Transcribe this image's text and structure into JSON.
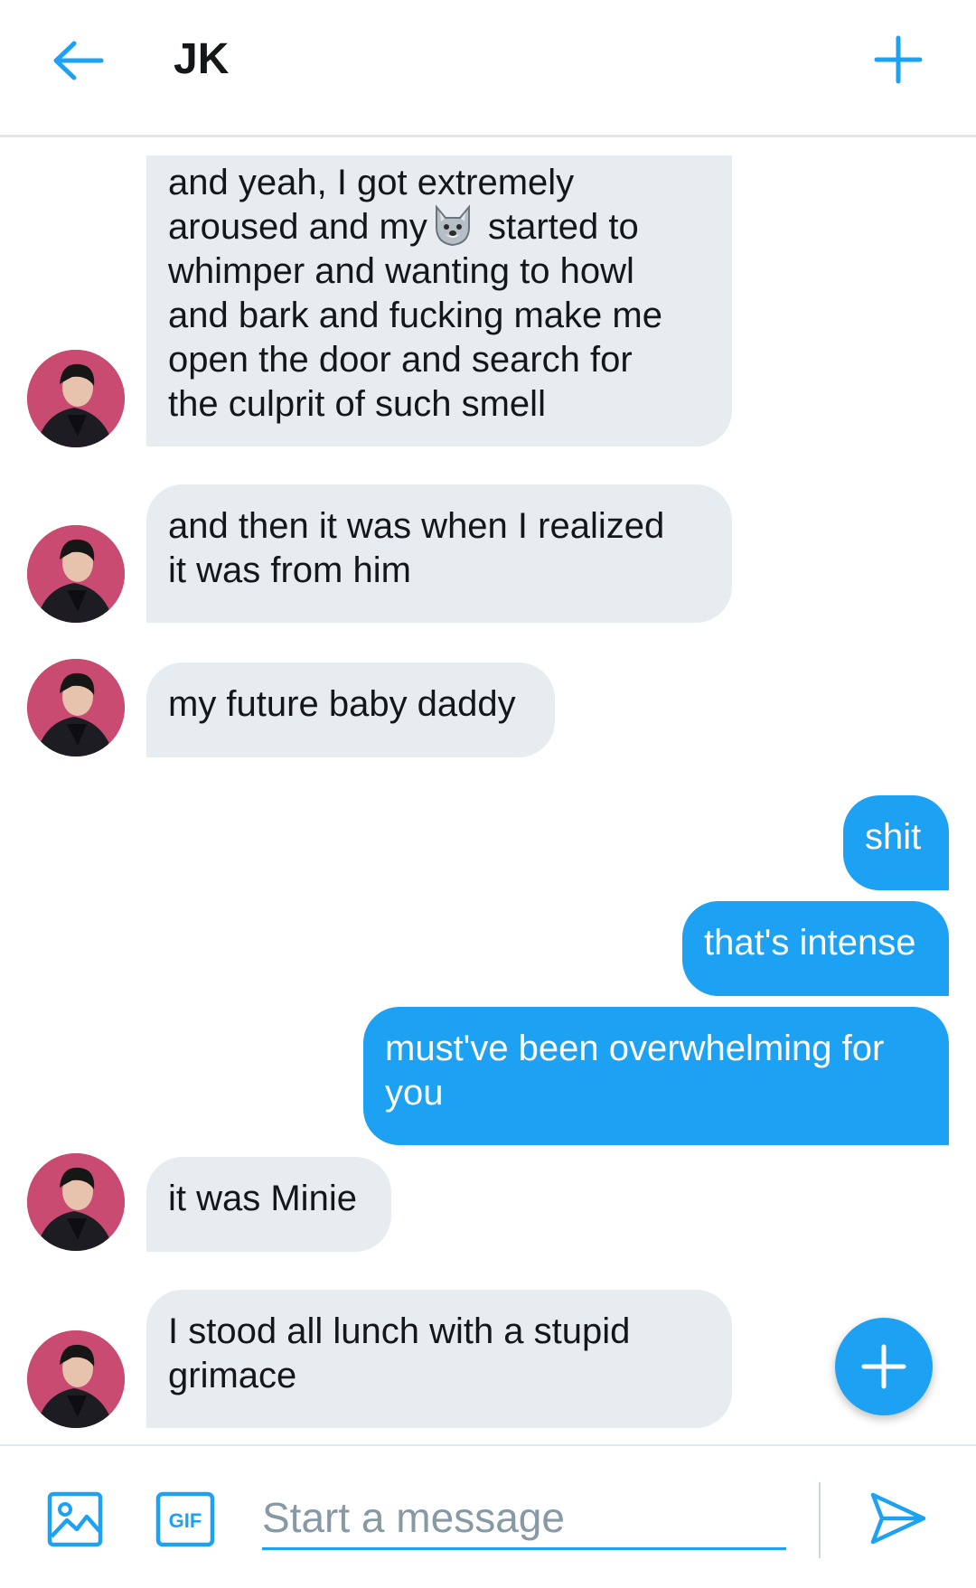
{
  "header": {
    "title": "JK",
    "back_icon": "arrow-left-icon",
    "action_icon": "plus-icon"
  },
  "colors": {
    "accent": "#1da1f2",
    "incoming_bubble": "#e6ecf0",
    "outgoing_text": "#ffffff",
    "divider": "#e1e8ed"
  },
  "messages": [
    {
      "direction": "in",
      "parts": {
        "a": "and yeah, I got extremely\naroused and my",
        "emoji": "wolf-emoji",
        "b": " started to\nwhimper and wanting to howl\nand bark and fucking make me\nopen the door and search for\nthe culprit of such smell"
      }
    },
    {
      "direction": "in",
      "text": "and then it was when I realized\nit was from him"
    },
    {
      "direction": "in",
      "text": "my future baby daddy"
    },
    {
      "direction": "out",
      "text": "shit"
    },
    {
      "direction": "out",
      "text": "that's intense"
    },
    {
      "direction": "out",
      "text": "must've been overwhelming for\nyou"
    },
    {
      "direction": "in",
      "text": "it was Minie"
    },
    {
      "direction": "in",
      "text": "I stood all lunch with a stupid\ngrimace"
    }
  ],
  "composer": {
    "placeholder": "Start a message",
    "gif_label": "GIF",
    "media_icon": "image-icon",
    "send_icon": "send-icon"
  },
  "fab": {
    "icon": "plus-icon"
  }
}
